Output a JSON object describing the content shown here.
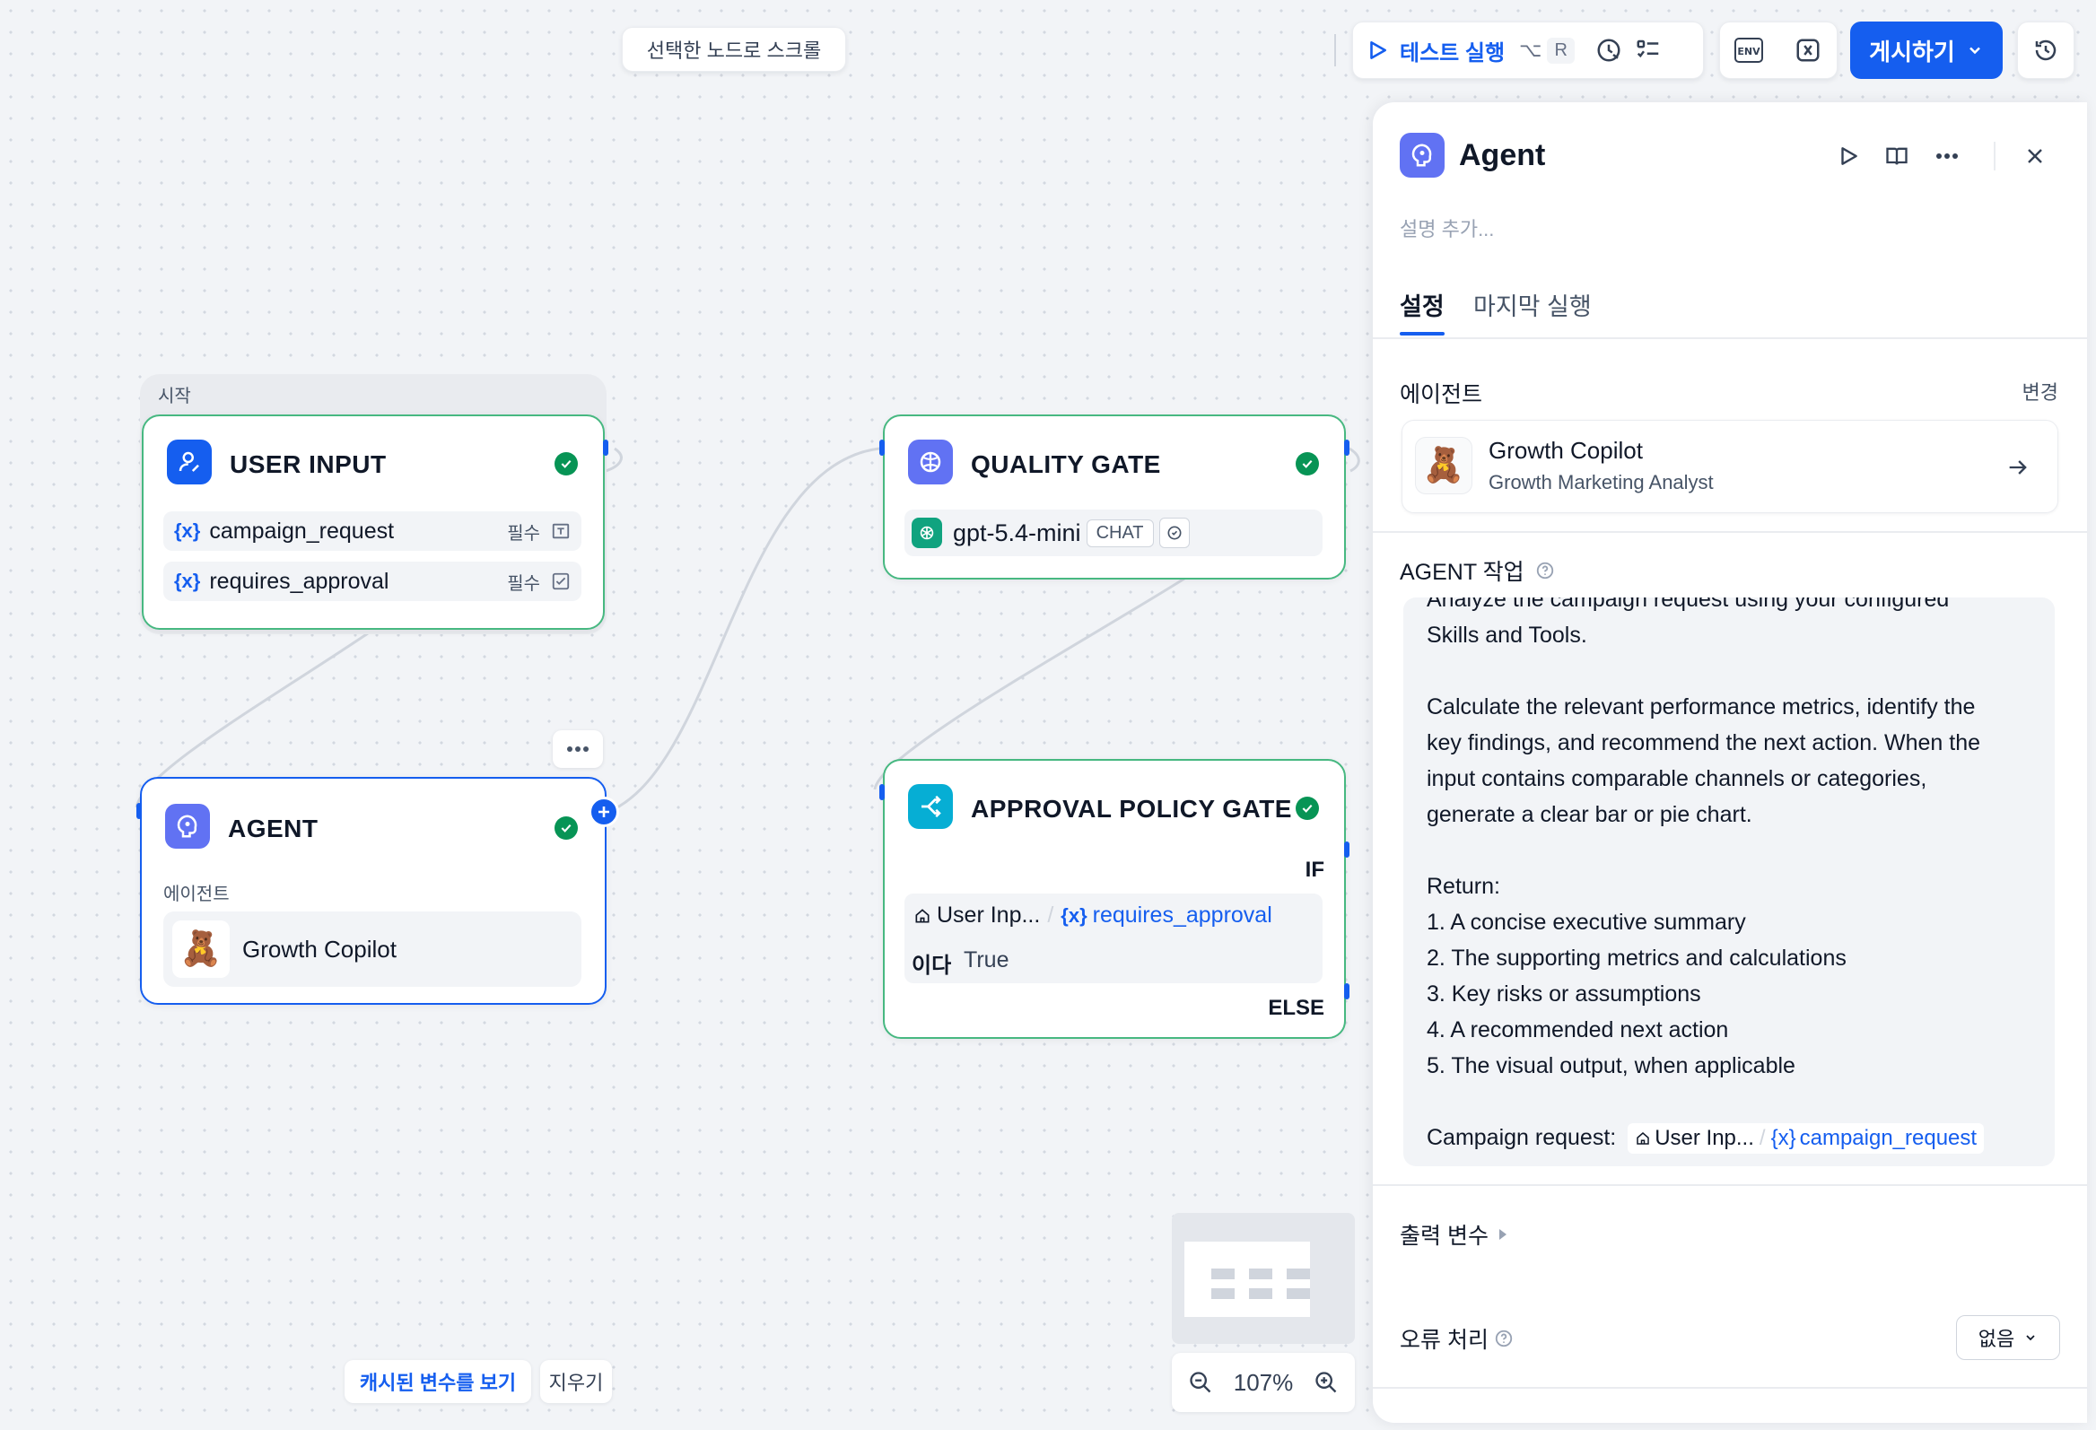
{
  "toolbar": {
    "scroll_to_selected": "선택한 노드로 스크롤",
    "test_run_label": "테스트 실행",
    "test_run_shortcut_mod": "⌥",
    "test_run_shortcut_key": "R",
    "env_label": "ENV",
    "publish_label": "게시하기"
  },
  "canvas": {
    "start_group_label": "시작",
    "user_input": {
      "title": "USER INPUT",
      "vars": [
        {
          "name": "campaign_request",
          "required": "필수"
        },
        {
          "name": "requires_approval",
          "required": "필수"
        }
      ]
    },
    "agent": {
      "title": "AGENT",
      "section_label": "에이전트",
      "agent_name": "Growth Copilot"
    },
    "quality_gate": {
      "title": "QUALITY GATE",
      "model": "gpt-5.4-mini",
      "model_tag": "CHAT"
    },
    "approval_gate": {
      "title": "APPROVAL POLICY GATE",
      "if_label": "IF",
      "cond_source": "User Inp...",
      "cond_sep": "/",
      "cond_var": "requires_approval",
      "operator": "이다",
      "value": "True",
      "else_label": "ELSE"
    },
    "cached_vars_label": "캐시된 변수를 보기",
    "clear_label": "지우기",
    "zoom": "107%"
  },
  "panel": {
    "title": "Agent",
    "description_placeholder": "설명 추가...",
    "tabs": [
      "설정",
      "마지막 실행"
    ],
    "agent_section_label": "에이전트",
    "change_label": "변경",
    "agent_card": {
      "name": "Growth Copilot",
      "role": "Growth Marketing Analyst"
    },
    "task_label": "AGENT 작업",
    "task_lines": [
      "Analyze the campaign request using your configured",
      "Skills and Tools.",
      "",
      "Calculate the relevant performance metrics, identify the",
      "key findings, and recommend the next action. When the",
      "input contains comparable channels or categories,",
      "generate a clear bar or pie chart.",
      "",
      "Return:",
      "1. A concise executive summary",
      "2. The supporting metrics and calculations",
      "3. Key risks or assumptions",
      "4. A recommended next action",
      "5. The visual output, when applicable",
      ""
    ],
    "task_tail_prefix": "Campaign request:",
    "task_tail_source": "User Inp...",
    "task_tail_sep": "/",
    "task_tail_var": "campaign_request",
    "output_vars_label": "출력 변수",
    "error_handling_label": "오류 처리",
    "error_handling_value": "없음"
  },
  "colors": {
    "accent": "#155eef",
    "success": "#079455",
    "node_border": "#47b881"
  }
}
